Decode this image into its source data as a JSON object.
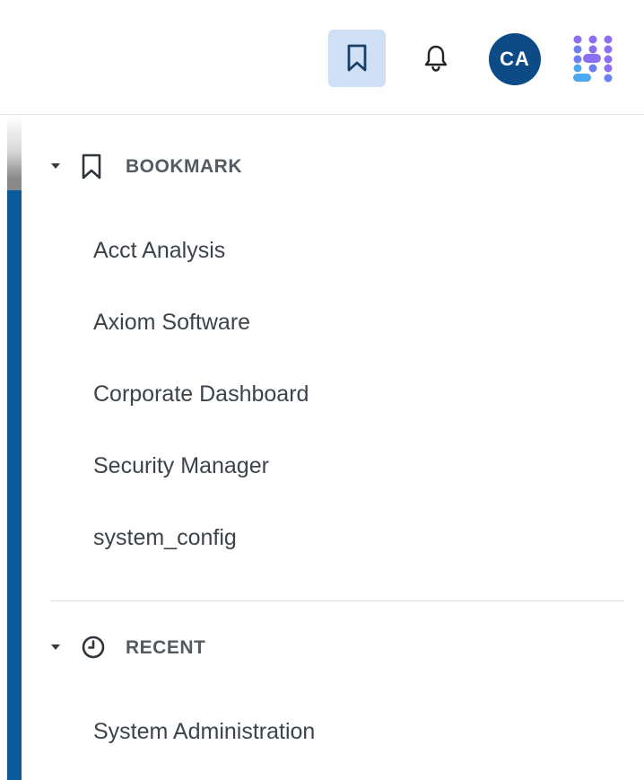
{
  "topbar": {
    "avatar_initials": "CA",
    "icons": [
      "bookmark-icon",
      "bell-icon",
      "app-grid-icon"
    ],
    "colors": {
      "avatar_bg": "#0d4b87",
      "bookmark_active_bg": "#cfe0f6",
      "accent": "#0b5a99"
    }
  },
  "bookmarks": {
    "title": "BOOKMARK",
    "items": [
      {
        "label": "Acct Analysis"
      },
      {
        "label": "Axiom Software"
      },
      {
        "label": "Corporate Dashboard"
      },
      {
        "label": "Security Manager"
      },
      {
        "label": "system_config"
      }
    ]
  },
  "recent": {
    "title": "RECENT",
    "items": [
      {
        "label": "System Administration"
      }
    ]
  }
}
